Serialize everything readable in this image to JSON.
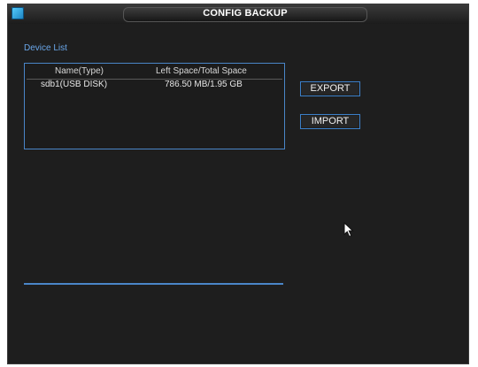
{
  "window": {
    "title": "CONFIG BACKUP",
    "icon": "app-icon"
  },
  "device_list": {
    "label": "Device List",
    "columns": [
      "Name(Type)",
      "Left Space/Total Space"
    ],
    "rows": [
      {
        "name": "sdb1(USB DISK)",
        "space": "786.50 MB/1.95 GB"
      }
    ]
  },
  "buttons": {
    "export": "EXPORT",
    "import": "IMPORT"
  },
  "colors": {
    "accent": "#4a86c8",
    "label_blue": "#6aa7ea",
    "background": "#1e1e1e"
  }
}
